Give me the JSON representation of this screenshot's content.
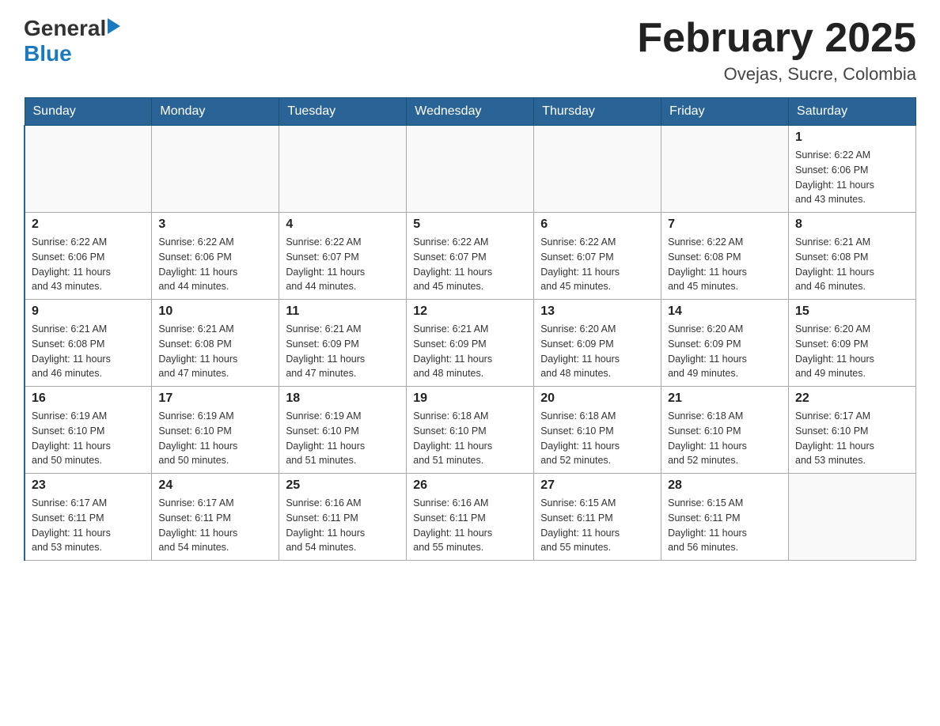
{
  "logo": {
    "general": "General",
    "arrow": "▶",
    "blue": "Blue"
  },
  "header": {
    "title": "February 2025",
    "subtitle": "Ovejas, Sucre, Colombia"
  },
  "weekdays": [
    "Sunday",
    "Monday",
    "Tuesday",
    "Wednesday",
    "Thursday",
    "Friday",
    "Saturday"
  ],
  "weeks": [
    [
      {
        "day": "",
        "info": ""
      },
      {
        "day": "",
        "info": ""
      },
      {
        "day": "",
        "info": ""
      },
      {
        "day": "",
        "info": ""
      },
      {
        "day": "",
        "info": ""
      },
      {
        "day": "",
        "info": ""
      },
      {
        "day": "1",
        "info": "Sunrise: 6:22 AM\nSunset: 6:06 PM\nDaylight: 11 hours\nand 43 minutes."
      }
    ],
    [
      {
        "day": "2",
        "info": "Sunrise: 6:22 AM\nSunset: 6:06 PM\nDaylight: 11 hours\nand 43 minutes."
      },
      {
        "day": "3",
        "info": "Sunrise: 6:22 AM\nSunset: 6:06 PM\nDaylight: 11 hours\nand 44 minutes."
      },
      {
        "day": "4",
        "info": "Sunrise: 6:22 AM\nSunset: 6:07 PM\nDaylight: 11 hours\nand 44 minutes."
      },
      {
        "day": "5",
        "info": "Sunrise: 6:22 AM\nSunset: 6:07 PM\nDaylight: 11 hours\nand 45 minutes."
      },
      {
        "day": "6",
        "info": "Sunrise: 6:22 AM\nSunset: 6:07 PM\nDaylight: 11 hours\nand 45 minutes."
      },
      {
        "day": "7",
        "info": "Sunrise: 6:22 AM\nSunset: 6:08 PM\nDaylight: 11 hours\nand 45 minutes."
      },
      {
        "day": "8",
        "info": "Sunrise: 6:21 AM\nSunset: 6:08 PM\nDaylight: 11 hours\nand 46 minutes."
      }
    ],
    [
      {
        "day": "9",
        "info": "Sunrise: 6:21 AM\nSunset: 6:08 PM\nDaylight: 11 hours\nand 46 minutes."
      },
      {
        "day": "10",
        "info": "Sunrise: 6:21 AM\nSunset: 6:08 PM\nDaylight: 11 hours\nand 47 minutes."
      },
      {
        "day": "11",
        "info": "Sunrise: 6:21 AM\nSunset: 6:09 PM\nDaylight: 11 hours\nand 47 minutes."
      },
      {
        "day": "12",
        "info": "Sunrise: 6:21 AM\nSunset: 6:09 PM\nDaylight: 11 hours\nand 48 minutes."
      },
      {
        "day": "13",
        "info": "Sunrise: 6:20 AM\nSunset: 6:09 PM\nDaylight: 11 hours\nand 48 minutes."
      },
      {
        "day": "14",
        "info": "Sunrise: 6:20 AM\nSunset: 6:09 PM\nDaylight: 11 hours\nand 49 minutes."
      },
      {
        "day": "15",
        "info": "Sunrise: 6:20 AM\nSunset: 6:09 PM\nDaylight: 11 hours\nand 49 minutes."
      }
    ],
    [
      {
        "day": "16",
        "info": "Sunrise: 6:19 AM\nSunset: 6:10 PM\nDaylight: 11 hours\nand 50 minutes."
      },
      {
        "day": "17",
        "info": "Sunrise: 6:19 AM\nSunset: 6:10 PM\nDaylight: 11 hours\nand 50 minutes."
      },
      {
        "day": "18",
        "info": "Sunrise: 6:19 AM\nSunset: 6:10 PM\nDaylight: 11 hours\nand 51 minutes."
      },
      {
        "day": "19",
        "info": "Sunrise: 6:18 AM\nSunset: 6:10 PM\nDaylight: 11 hours\nand 51 minutes."
      },
      {
        "day": "20",
        "info": "Sunrise: 6:18 AM\nSunset: 6:10 PM\nDaylight: 11 hours\nand 52 minutes."
      },
      {
        "day": "21",
        "info": "Sunrise: 6:18 AM\nSunset: 6:10 PM\nDaylight: 11 hours\nand 52 minutes."
      },
      {
        "day": "22",
        "info": "Sunrise: 6:17 AM\nSunset: 6:10 PM\nDaylight: 11 hours\nand 53 minutes."
      }
    ],
    [
      {
        "day": "23",
        "info": "Sunrise: 6:17 AM\nSunset: 6:11 PM\nDaylight: 11 hours\nand 53 minutes."
      },
      {
        "day": "24",
        "info": "Sunrise: 6:17 AM\nSunset: 6:11 PM\nDaylight: 11 hours\nand 54 minutes."
      },
      {
        "day": "25",
        "info": "Sunrise: 6:16 AM\nSunset: 6:11 PM\nDaylight: 11 hours\nand 54 minutes."
      },
      {
        "day": "26",
        "info": "Sunrise: 6:16 AM\nSunset: 6:11 PM\nDaylight: 11 hours\nand 55 minutes."
      },
      {
        "day": "27",
        "info": "Sunrise: 6:15 AM\nSunset: 6:11 PM\nDaylight: 11 hours\nand 55 minutes."
      },
      {
        "day": "28",
        "info": "Sunrise: 6:15 AM\nSunset: 6:11 PM\nDaylight: 11 hours\nand 56 minutes."
      },
      {
        "day": "",
        "info": ""
      }
    ]
  ]
}
